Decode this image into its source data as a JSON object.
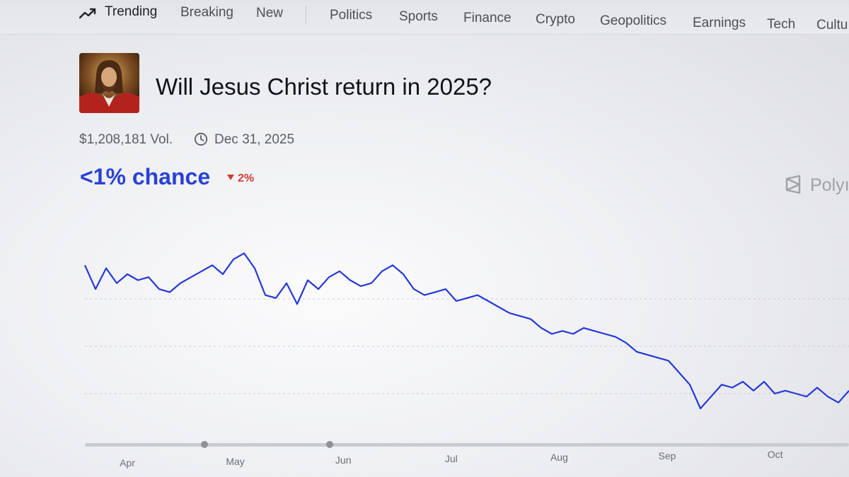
{
  "nav": {
    "trending": "Trending",
    "items": [
      "Breaking",
      "New",
      "Politics",
      "Sports",
      "Finance",
      "Crypto",
      "Geopolitics",
      "Earnings",
      "Tech",
      "Cultu"
    ]
  },
  "market": {
    "title": "Will Jesus Christ return in 2025?",
    "volume": "$1,208,181 Vol.",
    "end_date": "Dec 31, 2025",
    "chance": "<1% chance",
    "delta": "2%",
    "brand": "Polyı"
  },
  "colors": {
    "line": "#2438d8",
    "chance": "#2942d4",
    "delta": "#cf3b34"
  },
  "icons": [
    "trending-icon",
    "clock-icon",
    "polymarket-logo-icon",
    "caret-down-icon"
  ],
  "chart_data": {
    "type": "line",
    "x_ticks": [
      "Apr",
      "May",
      "Jun",
      "Jul",
      "Aug",
      "Sep",
      "Oct"
    ],
    "series": [
      {
        "values": [
          [
            0.0,
            3.0
          ],
          [
            0.2,
            2.6
          ],
          [
            0.4,
            2.95
          ],
          [
            0.6,
            2.7
          ],
          [
            0.8,
            2.85
          ],
          [
            1.0,
            2.75
          ],
          [
            1.2,
            2.8
          ],
          [
            1.4,
            2.6
          ],
          [
            1.6,
            2.55
          ],
          [
            1.8,
            2.7
          ],
          [
            2.0,
            2.8
          ],
          [
            2.2,
            2.9
          ],
          [
            2.4,
            3.0
          ],
          [
            2.6,
            2.85
          ],
          [
            2.8,
            3.1
          ],
          [
            3.0,
            3.2
          ],
          [
            3.2,
            2.95
          ],
          [
            3.4,
            2.5
          ],
          [
            3.6,
            2.45
          ],
          [
            3.8,
            2.7
          ],
          [
            4.0,
            2.35
          ],
          [
            4.2,
            2.75
          ],
          [
            4.4,
            2.6
          ],
          [
            4.6,
            2.8
          ],
          [
            4.8,
            2.9
          ],
          [
            5.0,
            2.75
          ],
          [
            5.2,
            2.65
          ],
          [
            5.4,
            2.7
          ],
          [
            5.6,
            2.9
          ],
          [
            5.8,
            3.0
          ],
          [
            6.0,
            2.85
          ],
          [
            6.2,
            2.6
          ],
          [
            6.4,
            2.5
          ],
          [
            6.6,
            2.55
          ],
          [
            6.8,
            2.6
          ],
          [
            7.0,
            2.4
          ],
          [
            7.2,
            2.45
          ],
          [
            7.4,
            2.5
          ],
          [
            7.6,
            2.4
          ],
          [
            7.8,
            2.3
          ],
          [
            8.0,
            2.2
          ],
          [
            8.2,
            2.15
          ],
          [
            8.4,
            2.1
          ],
          [
            8.6,
            1.95
          ],
          [
            8.8,
            1.85
          ],
          [
            9.0,
            1.9
          ],
          [
            9.2,
            1.85
          ],
          [
            9.4,
            1.95
          ],
          [
            9.6,
            1.9
          ],
          [
            9.8,
            1.85
          ],
          [
            10.0,
            1.8
          ],
          [
            10.2,
            1.7
          ],
          [
            10.4,
            1.55
          ],
          [
            10.6,
            1.5
          ],
          [
            10.8,
            1.45
          ],
          [
            11.0,
            1.4
          ],
          [
            11.2,
            1.2
          ],
          [
            11.4,
            1.0
          ],
          [
            11.6,
            0.6
          ],
          [
            11.8,
            0.8
          ],
          [
            12.0,
            1.0
          ],
          [
            12.2,
            0.95
          ],
          [
            12.4,
            1.05
          ],
          [
            12.6,
            0.9
          ],
          [
            12.8,
            1.05
          ],
          [
            13.0,
            0.85
          ],
          [
            13.2,
            0.9
          ],
          [
            13.4,
            0.85
          ],
          [
            13.6,
            0.8
          ],
          [
            13.8,
            0.95
          ],
          [
            14.0,
            0.8
          ],
          [
            14.2,
            0.7
          ],
          [
            14.4,
            0.9
          ]
        ]
      }
    ],
    "grid": true,
    "legend": "none"
  }
}
